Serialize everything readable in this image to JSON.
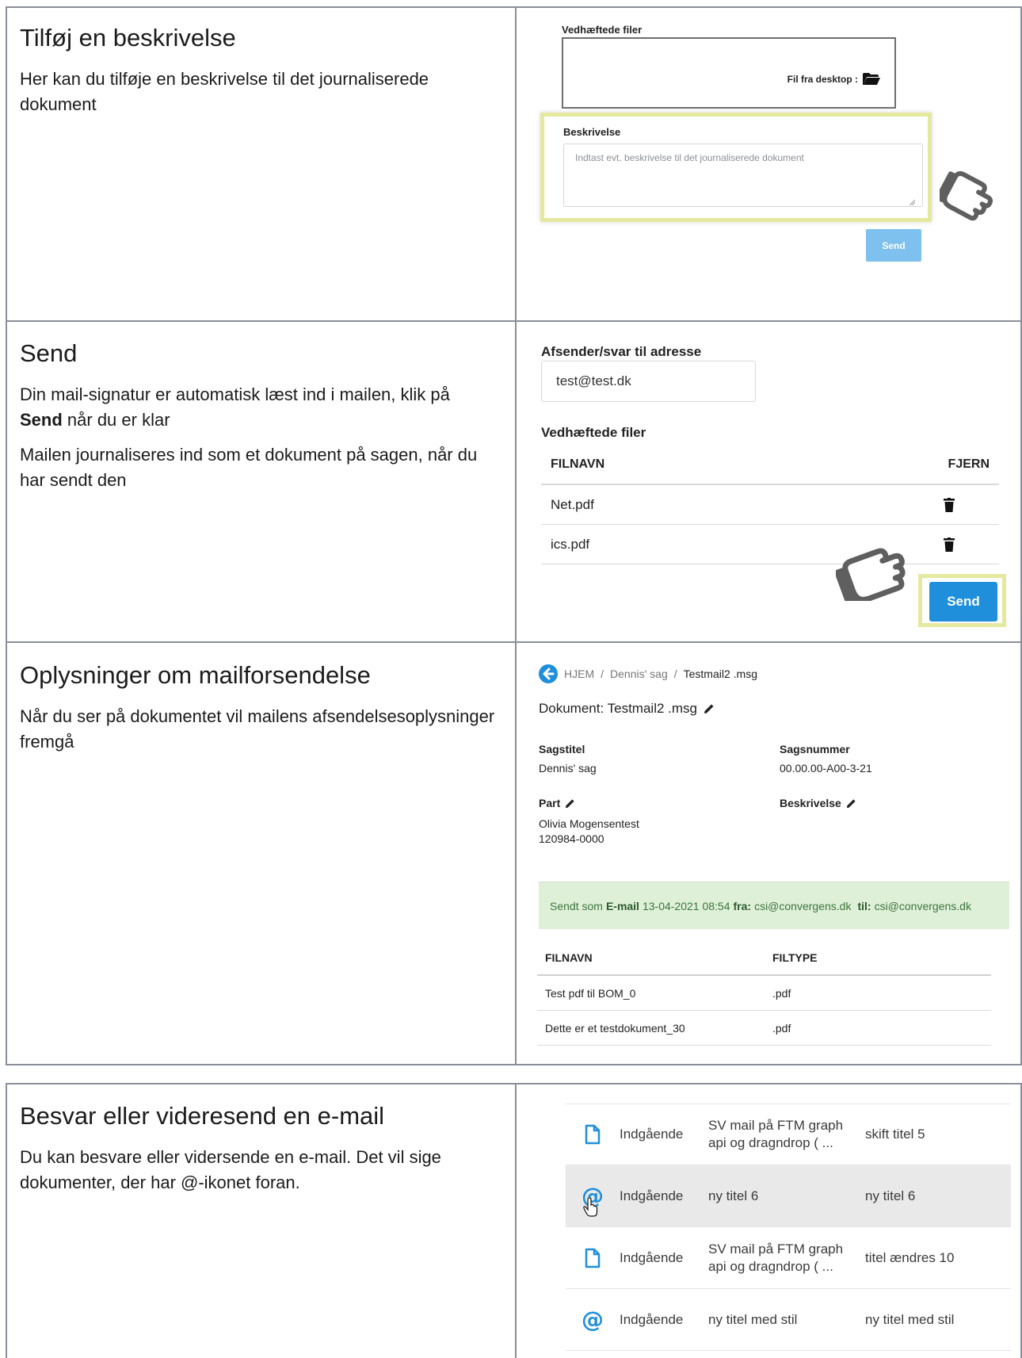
{
  "sections": [
    {
      "title": "Tilføj en beskrivelse",
      "paragraphs": [
        "Her kan du tilføje en beskrivelse til det journaliserede dokument"
      ]
    },
    {
      "title": "Send",
      "p1_before": "Din mail-signatur er automatisk læst ind i mailen, klik på ",
      "p1_bold": "Send",
      "p1_after": " når du er klar",
      "p2": "Mailen journaliseres ind som et dokument på sagen, når du har sendt den"
    },
    {
      "title": "Oplysninger om mailforsendelse",
      "paragraphs": [
        "Når du ser på dokumentet vil mailens afsendelsesoplysninger fremgå"
      ]
    },
    {
      "title": "Besvar eller videresend en e-mail",
      "paragraphs": [
        "Du kan besvare eller vidersende en e-mail. Det vil sige dokumenter, der har @-ikonet foran."
      ]
    }
  ],
  "shot1": {
    "files_label": "Vedhæftede filer",
    "desktop_label": "Fil fra desktop :",
    "desc_label": "Beskrivelse",
    "desc_placeholder": "Indtast evt. beskrivelse til det journaliserede dokument",
    "send_label": "Send"
  },
  "shot2": {
    "email_label": "Afsender/svar til adresse",
    "email_value": "test@test.dk",
    "files_label": "Vedhæftede filer",
    "col_name": "FILNAVN",
    "col_remove": "FJERN",
    "files": [
      "Net.pdf",
      "ics.pdf"
    ],
    "send_label": "Send"
  },
  "shot3": {
    "crumb_home": "HJEM",
    "crumb_case": "Dennis' sag",
    "crumb_doc": "Testmail2 .msg",
    "doc_title": "Dokument: Testmail2 .msg",
    "sagstitel_k": "Sagstitel",
    "sagstitel_v": "Dennis' sag",
    "sagsnummer_k": "Sagsnummer",
    "sagsnummer_v": "00.00.00-A00-3-21",
    "part_k": "Part",
    "part_name": "Olivia Mogensentest",
    "part_id": "120984-0000",
    "beskrivelse_k": "Beskrivelse",
    "sent_prefix": "Sendt som",
    "sent_type": "E-mail",
    "sent_date": "13-04-2021 08:54",
    "sent_from_k": "fra:",
    "sent_from": "csi@convergens.dk",
    "sent_to_k": "til:",
    "sent_to": "csi@convergens.dk",
    "col_name": "FILNAVN",
    "col_type": "FILTYPE",
    "files": [
      {
        "name": "Test pdf til BOM_0",
        "type": ".pdf"
      },
      {
        "name": "Dette er et testdokument_30",
        "type": ".pdf"
      }
    ]
  },
  "shot4": {
    "rows": [
      {
        "icon": "document-icon",
        "type": "Indgående",
        "subject1": "SV mail på FTM graph",
        "subject2": "api og dragndrop ( ...",
        "title": "skift titel 5"
      },
      {
        "icon": "at-icon",
        "type": "Indgående",
        "subject1": "ny titel 6",
        "subject2": "",
        "title": "ny titel 6"
      },
      {
        "icon": "document-icon",
        "type": "Indgående",
        "subject1": "SV mail på FTM graph",
        "subject2": "api og dragndrop ( ...",
        "title": "titel ændres 10"
      },
      {
        "icon": "at-icon",
        "type": "Indgående",
        "subject1": "ny titel med stil",
        "subject2": "",
        "title": "ny titel med stil"
      }
    ]
  }
}
